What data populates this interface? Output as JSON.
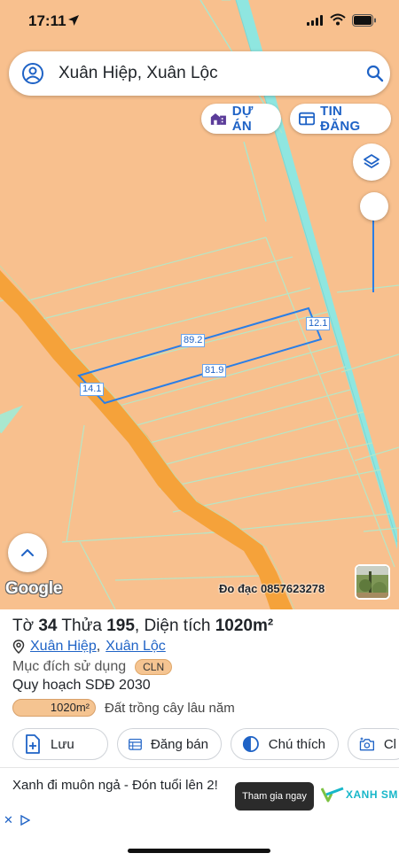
{
  "status": {
    "time": "17:11"
  },
  "search": {
    "query": "Xuân Hiệp, Xuân Lộc"
  },
  "chips": {
    "du_an": "DỰ ÁN",
    "tin_dang": "TIN ĐĂNG"
  },
  "map": {
    "dimensions": {
      "top": "89.2",
      "right": "12.1",
      "bottom": "81.9",
      "left": "14.1"
    },
    "google": "Google",
    "measure_contact": "Đo đạc 0857623278"
  },
  "parcel": {
    "to_label": "Tờ ",
    "to_value": "34",
    "thua_label": " Thửa ",
    "thua_value": "195",
    "area_label": ", Diện tích ",
    "area_value": "1020m²",
    "ward": "Xuân Hiệp",
    "district": "Xuân Lộc",
    "purpose_label": "Mục đích sử dụng",
    "purpose_code": "CLN",
    "plan_label": "Quy hoạch SDĐ 2030",
    "plan_area": "1020m²",
    "plan_desc": "Đất trồng cây lâu năm"
  },
  "actions": {
    "save": "Lưu",
    "sell": "Đăng bán",
    "legend": "Chú thích",
    "photo": "Cl"
  },
  "ad": {
    "text": "Xanh đi muôn ngả - Đón tuổi lên 2!",
    "cta": "Tham gia ngay",
    "brand": "XANH SM"
  },
  "colors": {
    "accent": "#1f63c6",
    "map_land": "#f8c08e",
    "road": "#f5a23a",
    "canal": "#8fe6e0",
    "plan_cln": "#f5c491"
  }
}
